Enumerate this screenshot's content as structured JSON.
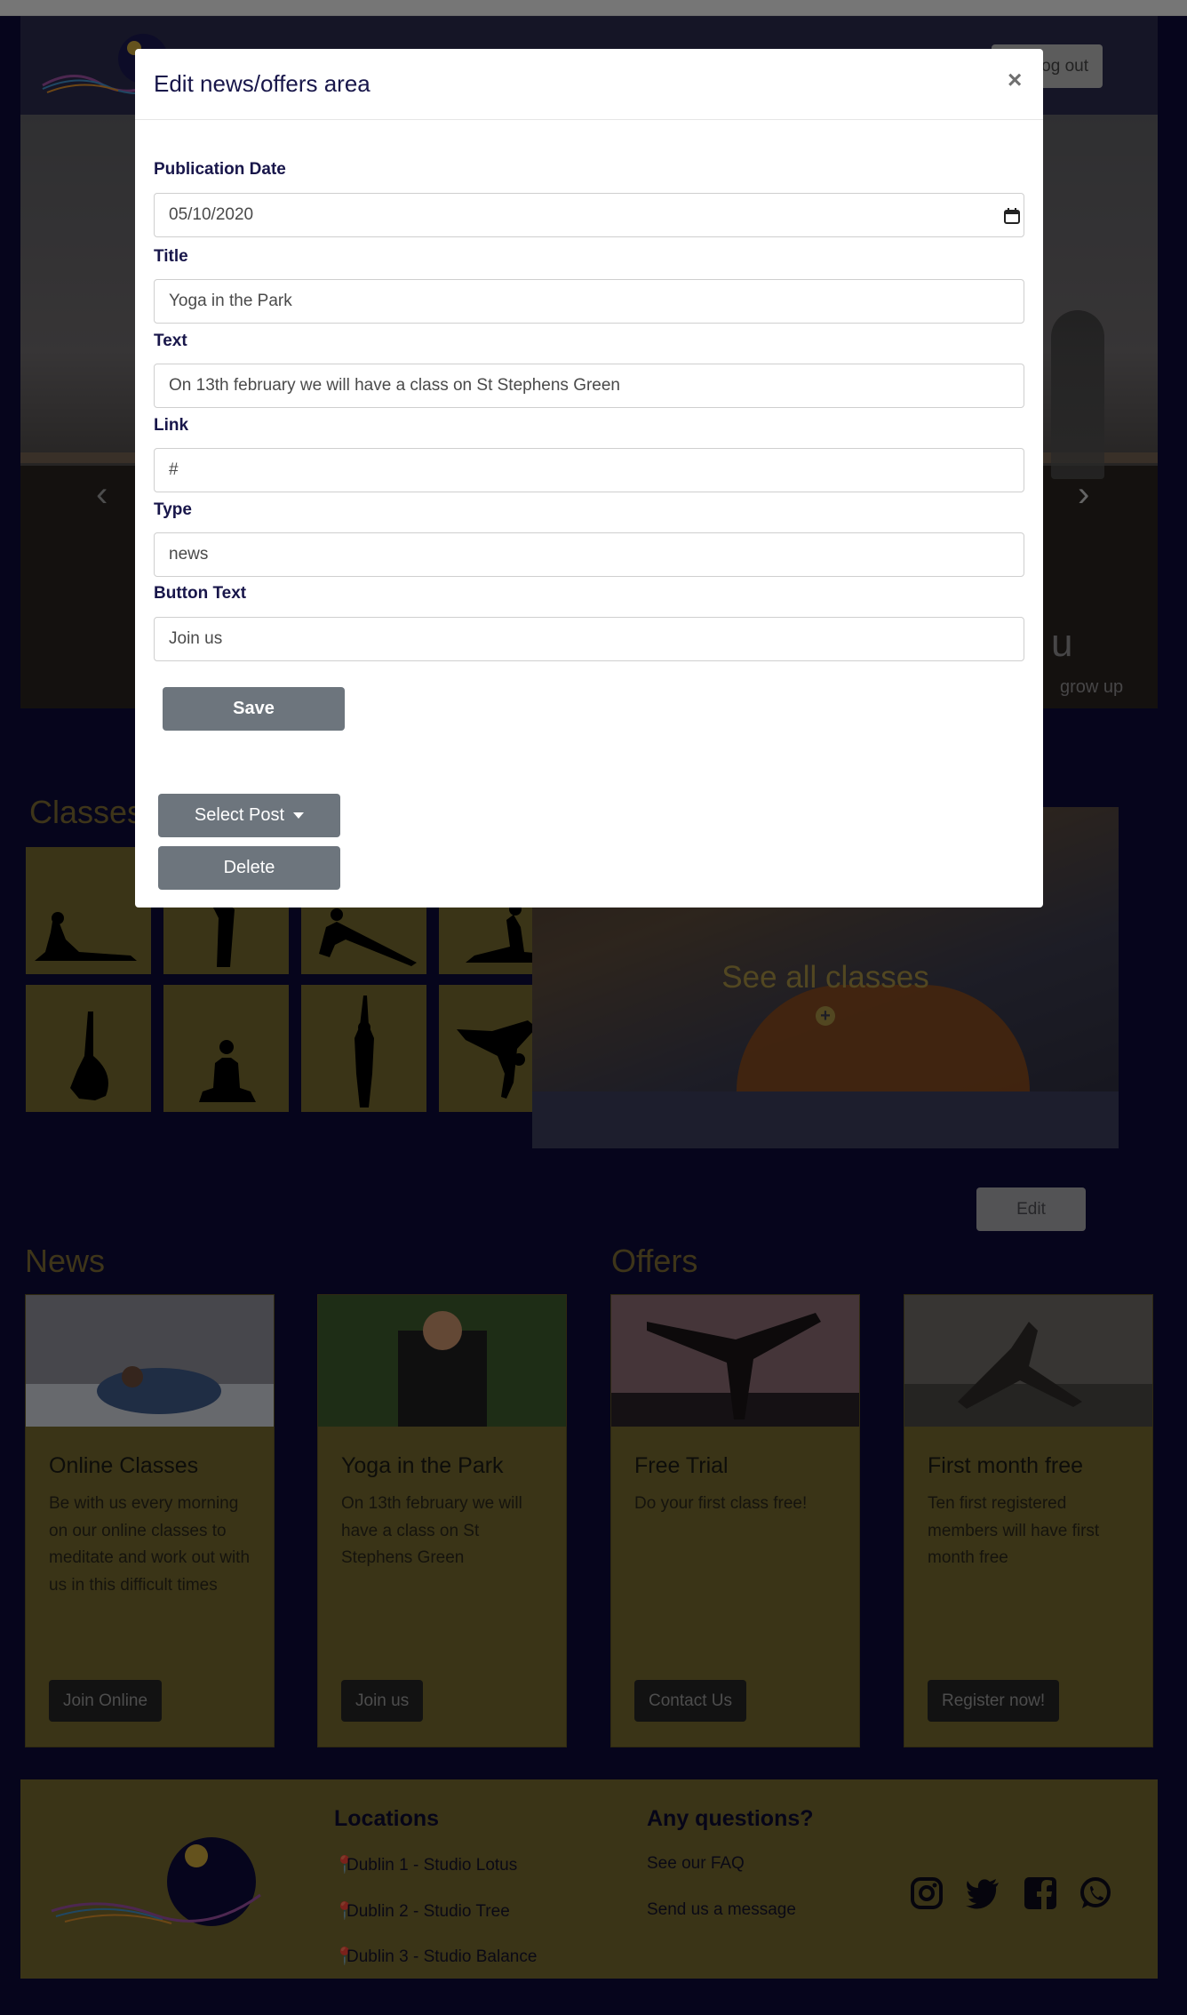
{
  "header": {
    "logout_label": "Log out"
  },
  "hero": {
    "title": "u",
    "subtitle": "grow up"
  },
  "classes": {
    "title": "Classes",
    "see_all_label": "See all classes"
  },
  "edit_label": "Edit",
  "news": {
    "title": "News",
    "cards": [
      {
        "title": "Online Classes",
        "text": "Be with us every morning on our online classes to meditate and work out with us in this difficult times",
        "button": "Join Online"
      },
      {
        "title": "Yoga in the Park",
        "text": "On 13th february we will have a class on St Stephens Green",
        "button": "Join us"
      }
    ]
  },
  "offers": {
    "title": "Offers",
    "cards": [
      {
        "title": "Free Trial",
        "text": "Do your first class free!",
        "button": "Contact Us"
      },
      {
        "title": "First month free",
        "text": "Ten first registered members will have first month free",
        "button": "Register now!"
      }
    ]
  },
  "footer": {
    "locations_title": "Locations",
    "locations": [
      "Dublin 1 - Studio Lotus",
      "Dublin 2 - Studio Tree",
      "Dublin 3 - Studio Balance"
    ],
    "questions_title": "Any questions?",
    "questions": [
      "See our FAQ",
      "Send us a message"
    ],
    "social_icons": [
      "instagram-icon",
      "twitter-icon",
      "facebook-icon",
      "whatsapp-icon"
    ]
  },
  "modal": {
    "title": "Edit news/offers area",
    "close": "×",
    "fields": [
      {
        "label": "Publication Date",
        "value": "05/10/2020"
      },
      {
        "label": "Title",
        "value": "Yoga in the Park"
      },
      {
        "label": "Text",
        "value": "On 13th february we will have a class on St Stephens Green"
      },
      {
        "label": "Link",
        "value": "#"
      },
      {
        "label": "Type",
        "value": "news"
      },
      {
        "label": "Button Text",
        "value": "Join us"
      }
    ],
    "save_label": "Save",
    "select_post_label": "Select Post",
    "delete_label": "Delete"
  },
  "colors": {
    "page_bg": "#0c0a38",
    "gold": "#74692e",
    "heading_gold": "#7c6b32",
    "button_gray": "#6d757d",
    "modal_text": "#18164a"
  }
}
